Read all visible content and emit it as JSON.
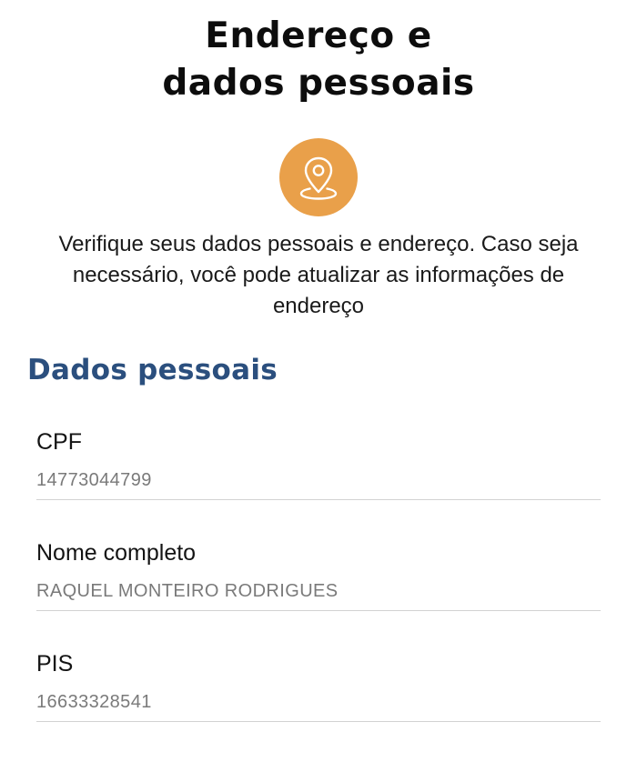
{
  "header": {
    "title_line1": "Endereço e",
    "title_line2": "dados pessoais"
  },
  "badge": {
    "icon": "map-pin-icon",
    "color": "#e9a04a"
  },
  "intro": {
    "text": "Verifique seus dados pessoais e endereço. Caso seja necessário, você pode atualizar as informações de endereço"
  },
  "section": {
    "title": "Dados pessoais",
    "color": "#2b4f7e"
  },
  "fields": [
    {
      "label": "CPF",
      "value": "14773044799"
    },
    {
      "label": "Nome completo",
      "value": "RAQUEL MONTEIRO RODRIGUES"
    },
    {
      "label": "PIS",
      "value": "16633328541"
    }
  ]
}
